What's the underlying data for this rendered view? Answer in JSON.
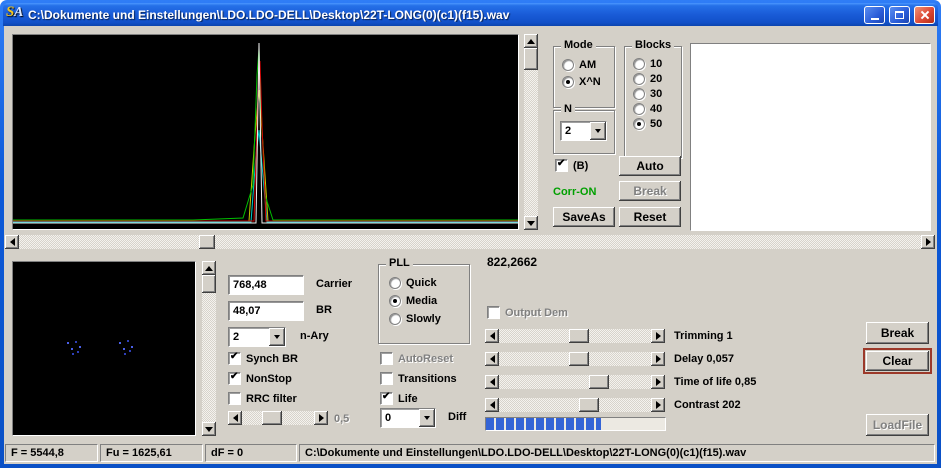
{
  "window": {
    "title": "C:\\Dokumente und Einstellungen\\LDO.LDO-DELL\\Desktop\\22T-LONG(0)(c1)(f15).wav",
    "logo_s": "S",
    "logo_a": "A"
  },
  "analysis": {
    "mode": {
      "label": "Mode",
      "options": [
        {
          "label": "AM",
          "selected": false
        },
        {
          "label": "X^N",
          "selected": true
        }
      ]
    },
    "blocks": {
      "label": "Blocks",
      "options": [
        {
          "label": "10",
          "selected": false
        },
        {
          "label": "20",
          "selected": false
        },
        {
          "label": "30",
          "selected": false
        },
        {
          "label": "40",
          "selected": false
        },
        {
          "label": "50",
          "selected": true
        }
      ]
    },
    "n": {
      "label": "N",
      "value": "2"
    },
    "b_check": {
      "label": "(B)",
      "checked": true
    },
    "auto_button": "Auto",
    "corr_status": "Corr-ON",
    "break_button": "Break",
    "saveas_button": "SaveAs",
    "reset_button": "Reset"
  },
  "demod": {
    "carrier": {
      "value": "768,48",
      "label": "Carrier"
    },
    "br": {
      "value": "48,07",
      "label": "BR"
    },
    "nary": {
      "value": "2",
      "label": "n-Ary"
    },
    "synch_br": {
      "label": "Synch BR",
      "checked": true
    },
    "nonstop": {
      "label": "NonStop",
      "checked": true
    },
    "rrc_filter": {
      "label": "RRC filter",
      "checked": false
    },
    "rrc_value": "0,5",
    "pll": {
      "label": "PLL",
      "options": [
        {
          "label": "Quick",
          "selected": false
        },
        {
          "label": "Media",
          "selected": true
        },
        {
          "label": "Slowly",
          "selected": false
        }
      ]
    },
    "autoreset": {
      "label": "AutoReset",
      "checked": false,
      "disabled": true
    },
    "transitions": {
      "label": "Transitions",
      "checked": false
    },
    "life": {
      "label": "Life",
      "checked": true
    },
    "diff": {
      "value": "0",
      "label": "Diff"
    }
  },
  "output": {
    "freq_value": "822,2662",
    "output_dem": {
      "label": "Output Dem",
      "disabled": true
    },
    "sliders": [
      {
        "label": "Trimming 1",
        "position_pct": 50
      },
      {
        "label": "Delay  0,057",
        "position_pct": 50
      },
      {
        "label": "Time of life 0,85",
        "position_pct": 63
      },
      {
        "label": "Contrast 202",
        "position_pct": 57
      }
    ],
    "progress_pct": 64,
    "break_button": "Break",
    "clear_button": "Clear",
    "loadfile_button": "LoadFile"
  },
  "status_bar": {
    "f": "F = 5544,8",
    "fu": "Fu = 1625,61",
    "df": "dF = 0",
    "file_path": "C:\\Dokumente und Einstellungen\\LDO.LDO-DELL\\Desktop\\22T-LONG(0)(c1)(f15).wav"
  },
  "colors": {
    "corr_on": "#00A000",
    "progress": "#3464D6",
    "spectrum_bg": "#000000"
  }
}
